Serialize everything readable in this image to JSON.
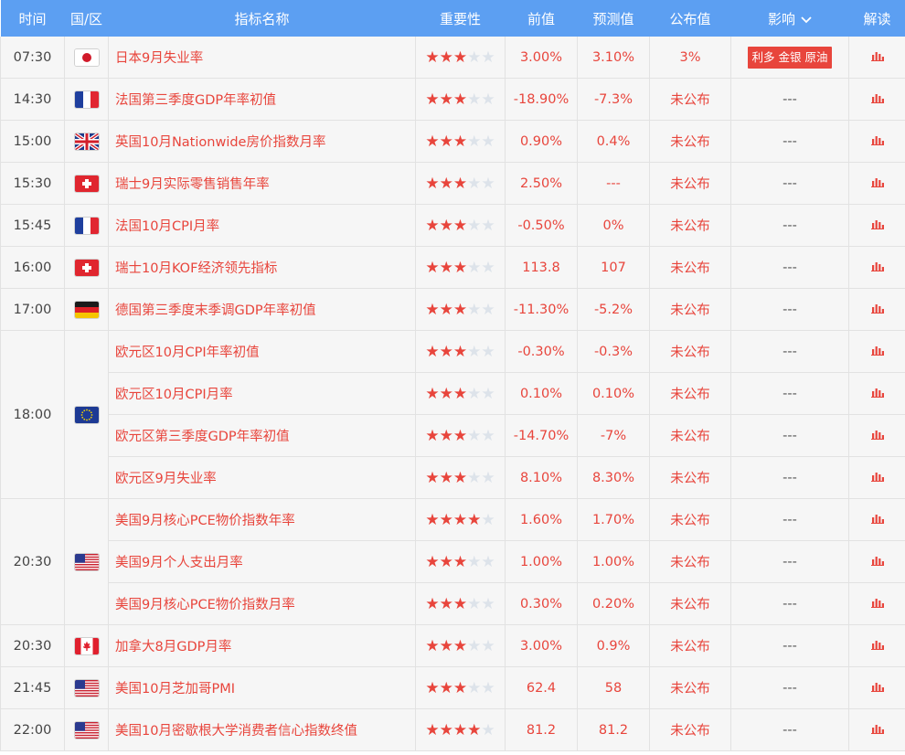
{
  "header": {
    "time": "时间",
    "country": "国/区",
    "indicator": "指标名称",
    "importance": "重要性",
    "previous": "前值",
    "forecast": "预测值",
    "actual": "公布值",
    "impact": "影响",
    "analysis": "解读"
  },
  "colors": {
    "header_bg": "#5c9ff2",
    "accent": "#e8453c",
    "star_off": "#dde3ea",
    "row_bg": "#f6f6f6"
  },
  "icons": {
    "impact_dropdown": "chevron-down-icon",
    "analysis": "bar-chart-icon",
    "star": "star-icon"
  },
  "rows": [
    {
      "time": "07:30",
      "flag": "japan",
      "name": "日本9月失业率",
      "stars": 3,
      "previous": "3.00%",
      "forecast": "3.10%",
      "actual": "3%",
      "impact": "利多 金银 原油"
    },
    {
      "time": "14:30",
      "flag": "france",
      "name": "法国第三季度GDP年率初值",
      "stars": 3,
      "previous": "-18.90%",
      "forecast": "-7.3%",
      "actual": "未公布",
      "impact": "---"
    },
    {
      "time": "15:00",
      "flag": "uk",
      "name": "英国10月Nationwide房价指数月率",
      "stars": 3,
      "previous": "0.90%",
      "forecast": "0.4%",
      "actual": "未公布",
      "impact": "---"
    },
    {
      "time": "15:30",
      "flag": "switzerland",
      "name": "瑞士9月实际零售销售年率",
      "stars": 3,
      "previous": "2.50%",
      "forecast": "---",
      "actual": "未公布",
      "impact": "---"
    },
    {
      "time": "15:45",
      "flag": "france",
      "name": "法国10月CPI月率",
      "stars": 3,
      "previous": "-0.50%",
      "forecast": "0%",
      "actual": "未公布",
      "impact": "---"
    },
    {
      "time": "16:00",
      "flag": "switzerland",
      "name": "瑞士10月KOF经济领先指标",
      "stars": 3,
      "previous": "113.8",
      "forecast": "107",
      "actual": "未公布",
      "impact": "---"
    },
    {
      "time": "17:00",
      "flag": "germany",
      "name": "德国第三季度末季调GDP年率初值",
      "stars": 3,
      "previous": "-11.30%",
      "forecast": "-5.2%",
      "actual": "未公布",
      "impact": "---"
    },
    {
      "time": "18:00",
      "flag": "eu",
      "span": 4,
      "name": "欧元区10月CPI年率初值",
      "stars": 3,
      "previous": "-0.30%",
      "forecast": "-0.3%",
      "actual": "未公布",
      "impact": "---"
    },
    {
      "time": "",
      "flag": "",
      "cont": true,
      "name": "欧元区10月CPI月率",
      "stars": 3,
      "previous": "0.10%",
      "forecast": "0.10%",
      "actual": "未公布",
      "impact": "---"
    },
    {
      "time": "",
      "flag": "",
      "cont": true,
      "name": "欧元区第三季度GDP年率初值",
      "stars": 3,
      "previous": "-14.70%",
      "forecast": "-7%",
      "actual": "未公布",
      "impact": "---"
    },
    {
      "time": "",
      "flag": "",
      "cont": true,
      "name": "欧元区9月失业率",
      "stars": 3,
      "previous": "8.10%",
      "forecast": "8.30%",
      "actual": "未公布",
      "impact": "---"
    },
    {
      "time": "20:30",
      "flag": "usa",
      "span": 3,
      "name": "美国9月核心PCE物价指数年率",
      "stars": 4,
      "previous": "1.60%",
      "forecast": "1.70%",
      "actual": "未公布",
      "impact": "---"
    },
    {
      "time": "",
      "flag": "",
      "cont": true,
      "name": "美国9月个人支出月率",
      "stars": 3,
      "previous": "1.00%",
      "forecast": "1.00%",
      "actual": "未公布",
      "impact": "---"
    },
    {
      "time": "",
      "flag": "",
      "cont": true,
      "name": "美国9月核心PCE物价指数月率",
      "stars": 3,
      "previous": "0.30%",
      "forecast": "0.20%",
      "actual": "未公布",
      "impact": "---"
    },
    {
      "time": "20:30",
      "flag": "canada",
      "name": "加拿大8月GDP月率",
      "stars": 3,
      "previous": "3.00%",
      "forecast": "0.9%",
      "actual": "未公布",
      "impact": "---"
    },
    {
      "time": "21:45",
      "flag": "usa",
      "name": "美国10月芝加哥PMI",
      "stars": 3,
      "previous": "62.4",
      "forecast": "58",
      "actual": "未公布",
      "impact": "---"
    },
    {
      "time": "22:00",
      "flag": "usa",
      "name": "美国10月密歇根大学消费者信心指数终值",
      "stars": 4,
      "previous": "81.2",
      "forecast": "81.2",
      "actual": "未公布",
      "impact": "---"
    }
  ]
}
